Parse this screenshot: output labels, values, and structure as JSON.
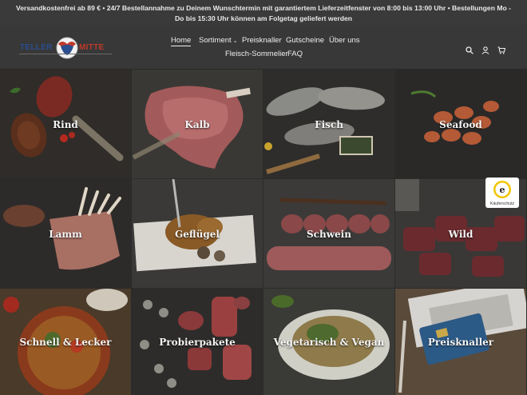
{
  "announcement": {
    "text": "Versandkostenfrei ab 89 € • 24/7 Bestellannahme zu Deinem Wunschtermin mit garantiertem Lieferzeitfenster von 8:00 bis 13:00 Uhr • Bestellungen Mo - Do bis 15:30 Uhr können am Folgetag geliefert werden"
  },
  "header": {
    "logo": {
      "left_word": "TELLER",
      "right_word": "MITTE"
    },
    "nav": [
      {
        "label": "Home",
        "active": true
      },
      {
        "label": "Sortiment",
        "has_dropdown": true,
        "caret": "⌄"
      },
      {
        "label": "Preisknaller"
      },
      {
        "label": "Gutscheine"
      },
      {
        "label": "Über uns"
      },
      {
        "label": "Fleisch-Sommelier"
      },
      {
        "label": "FAQ"
      }
    ],
    "icons": [
      "search-icon",
      "account-icon",
      "cart-icon"
    ]
  },
  "categories": [
    {
      "label": "Rind"
    },
    {
      "label": "Kalb"
    },
    {
      "label": "Fisch"
    },
    {
      "label": "Seafood"
    },
    {
      "label": "Lamm"
    },
    {
      "label": "Geflügel"
    },
    {
      "label": "Schwein"
    },
    {
      "label": "Wild"
    },
    {
      "label": "Schnell & Lecker"
    },
    {
      "label": "Probierpakete"
    },
    {
      "label": "Vegetarisch & Vegan"
    },
    {
      "label": "Preisknaller"
    }
  ],
  "trust_badge": {
    "text": "Käuferschutz",
    "symbol": "e"
  },
  "colors": {
    "header_bg": "#383838",
    "announce_bg": "#3a3a3a",
    "logo_blue": "#2b4e8f",
    "logo_red": "#c0392b"
  }
}
